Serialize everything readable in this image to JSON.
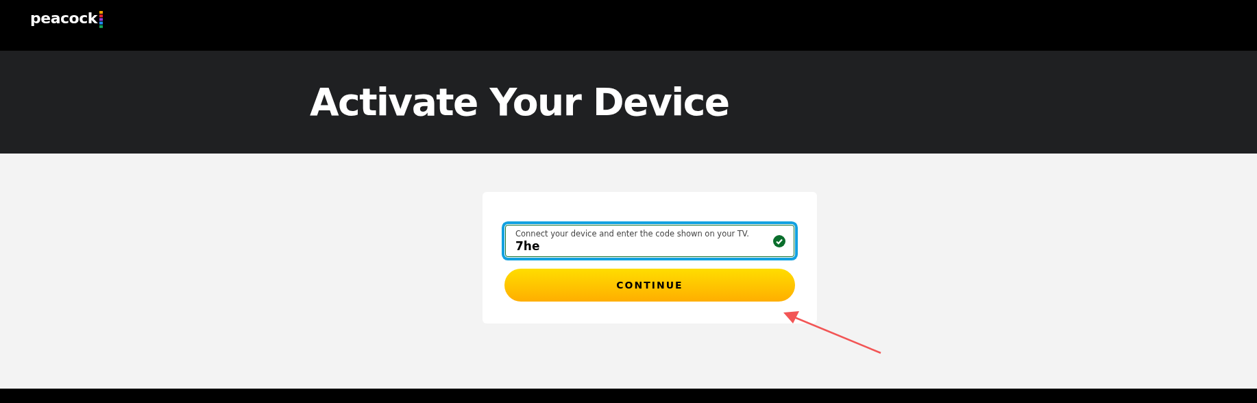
{
  "header": {
    "logo": "peacock"
  },
  "hero": {
    "title": "Activate Your Device"
  },
  "form": {
    "code_field": {
      "label": "Connect your device and enter the code shown on your TV.",
      "value": "7he",
      "valid": true
    },
    "button": "CONTINUE"
  }
}
